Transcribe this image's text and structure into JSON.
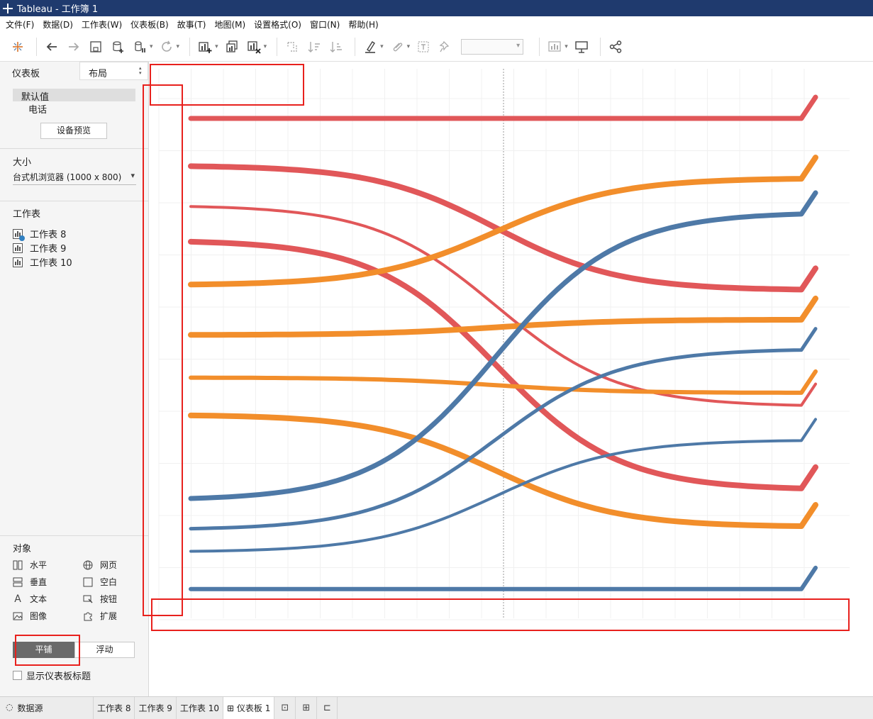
{
  "window": {
    "title": "Tableau - 工作簿 1"
  },
  "menu": [
    "文件(F)",
    "数据(D)",
    "工作表(W)",
    "仪表板(B)",
    "故事(T)",
    "地图(M)",
    "设置格式(O)",
    "窗口(N)",
    "帮助(H)"
  ],
  "toolbar": {
    "icons": [
      "tableau-logo-icon",
      "undo-icon",
      "redo-icon",
      "save-icon",
      "new-datasource-icon",
      "pause-update-icon",
      "refresh-icon",
      "new-worksheet-icon",
      "duplicate-icon",
      "clear-sheet-icon",
      "swap-icon",
      "sort-ascending-icon",
      "sort-descending-icon",
      "highlight-icon",
      "group-icon",
      "show-labels-icon",
      "pin-icon",
      "show-me-icon",
      "presentation-icon",
      "share-icon"
    ],
    "fit_combo": ""
  },
  "left_panel": {
    "tab_dashboard": "仪表板",
    "tab_layout": "布局",
    "device_default": "默认值",
    "device_phone": "电话",
    "device_preview_button": "设备预览",
    "size_title": "大小",
    "size_value": "台式机浏览器 (1000 x 800)",
    "sheets_title": "工作表",
    "sheets": [
      "工作表 8",
      "工作表 9",
      "工作表 10"
    ],
    "objects_title": "对象",
    "objects": [
      {
        "label": "水平",
        "icon": "horizontal-container-icon"
      },
      {
        "label": "网页",
        "icon": "web-page-icon"
      },
      {
        "label": "垂直",
        "icon": "vertical-container-icon"
      },
      {
        "label": "空白",
        "icon": "blank-icon"
      },
      {
        "label": "文本",
        "icon": "text-icon"
      },
      {
        "label": "按钮",
        "icon": "button-icon"
      },
      {
        "label": "图像",
        "icon": "image-icon"
      },
      {
        "label": "扩展",
        "icon": "extension-icon"
      }
    ],
    "tile_button": "平铺",
    "float_button": "浮动",
    "show_title_checkbox": "显示仪表板标题"
  },
  "bottom_tabs": {
    "datasource": "数据源",
    "sheets": [
      "工作表 8",
      "工作表 9",
      "工作表 10",
      "仪表板 1"
    ],
    "active": "仪表板 1",
    "new_icons": [
      "new-worksheet-tab-icon",
      "new-dashboard-tab-icon",
      "new-story-tab-icon"
    ]
  },
  "colors": {
    "red": "#e15759",
    "orange": "#f28e2b",
    "blue": "#4e79a7",
    "annotation": "#e8211d",
    "titlebar": "#1f3a6e"
  },
  "chart_data": {
    "type": "line",
    "subtype": "sigmoid-bump",
    "title": "",
    "xlabel": "",
    "ylabel": "",
    "x_range": [
      0,
      1
    ],
    "y_range": [
      0,
      1
    ],
    "grid": true,
    "series": [
      {
        "color": "red",
        "width": 7,
        "start": 0.955,
        "end": 0.955
      },
      {
        "color": "red",
        "width": 8,
        "start": 0.86,
        "end": 0.615
      },
      {
        "color": "red",
        "width": 4,
        "start": 0.78,
        "end": 0.385
      },
      {
        "color": "red",
        "width": 8,
        "start": 0.71,
        "end": 0.22
      },
      {
        "color": "orange",
        "width": 8,
        "start": 0.625,
        "end": 0.835
      },
      {
        "color": "orange",
        "width": 8,
        "start": 0.525,
        "end": 0.555
      },
      {
        "color": "orange",
        "width": 6,
        "start": 0.44,
        "end": 0.41
      },
      {
        "color": "orange",
        "width": 8,
        "start": 0.365,
        "end": 0.145
      },
      {
        "color": "blue",
        "width": 7,
        "start": 0.2,
        "end": 0.765
      },
      {
        "color": "blue",
        "width": 5,
        "start": 0.14,
        "end": 0.495
      },
      {
        "color": "blue",
        "width": 4,
        "start": 0.095,
        "end": 0.315
      },
      {
        "color": "blue",
        "width": 6,
        "start": 0.02,
        "end": 0.02
      }
    ]
  }
}
